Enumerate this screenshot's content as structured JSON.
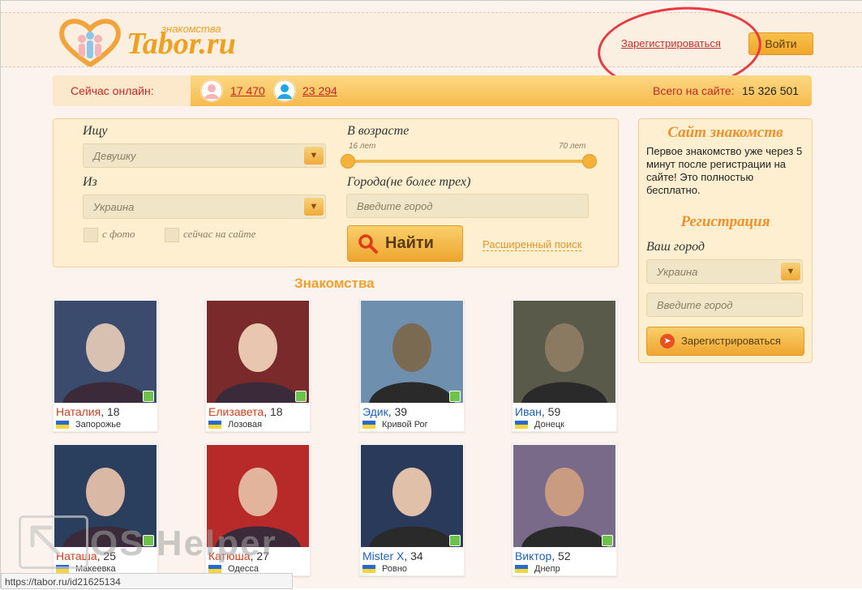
{
  "header": {
    "logo_text": "Tabor.ru",
    "logo_subtitle": "знакомства",
    "register_link": "Зарегистрироваться",
    "login_button": "Войти"
  },
  "online": {
    "label": "Сейчас онлайн:",
    "women_count": "17 470",
    "men_count": "23 294",
    "total_label": "Всего на сайте:",
    "total_value": "15 326 501"
  },
  "search": {
    "seek_label": "Ищу",
    "seek_value": "Девушку",
    "from_label": "Из",
    "from_value": "Украина",
    "with_photo": "с фото",
    "online_now": "сейчас на сайте",
    "age_label": "В возрасте",
    "age_min": "16 лет",
    "age_max": "70 лет",
    "age_min_value": 16,
    "age_max_value": 70,
    "cities_label": "Города(не более трех)",
    "city_placeholder": "Введите город",
    "find_button": "Найти",
    "extended_search_1": "Расширенный",
    "extended_search_2": "поиск"
  },
  "section_title": "Знакомства",
  "profiles": [
    {
      "name": "Наталия",
      "age": ", 18",
      "city": "Запорожье",
      "gender": "f",
      "android": true
    },
    {
      "name": "Елизавета",
      "age": ", 18",
      "city": "Лозовая",
      "gender": "f",
      "android": true
    },
    {
      "name": "Эдик",
      "age": ", 39",
      "city": "Кривой Рог",
      "gender": "m",
      "android": true
    },
    {
      "name": "Иван",
      "age": ", 59",
      "city": "Донецк",
      "gender": "m",
      "android": false
    },
    {
      "name": "Наташа",
      "age": ", 25",
      "city": "Макеевка",
      "gender": "f",
      "android": true
    },
    {
      "name": "Катюша",
      "age": ", 27",
      "city": "Одесса",
      "gender": "f",
      "android": false
    },
    {
      "name": "Mister X",
      "age": ", 34",
      "city": "Ровно",
      "gender": "m",
      "android": true
    },
    {
      "name": "Виктор",
      "age": ", 52",
      "city": "Днепр",
      "gender": "m",
      "android": true
    }
  ],
  "sidebar": {
    "title": "Сайт знакомств",
    "text": "Первое знакомство уже через 5 минут после регистрации на сайте! Это полностью бесплатно.",
    "reg_title": "Регистрация",
    "city_label": "Ваш город",
    "country_value": "Украина",
    "city_placeholder": "Введите город",
    "register_button": "Зарегистрироваться"
  },
  "watermark": "OS Helper",
  "status_url": "https://tabor.ru/id21625134",
  "colors": {
    "female_name": "#c8401f",
    "male_name": "#1f5fb8",
    "accent": "#f0a02a"
  }
}
